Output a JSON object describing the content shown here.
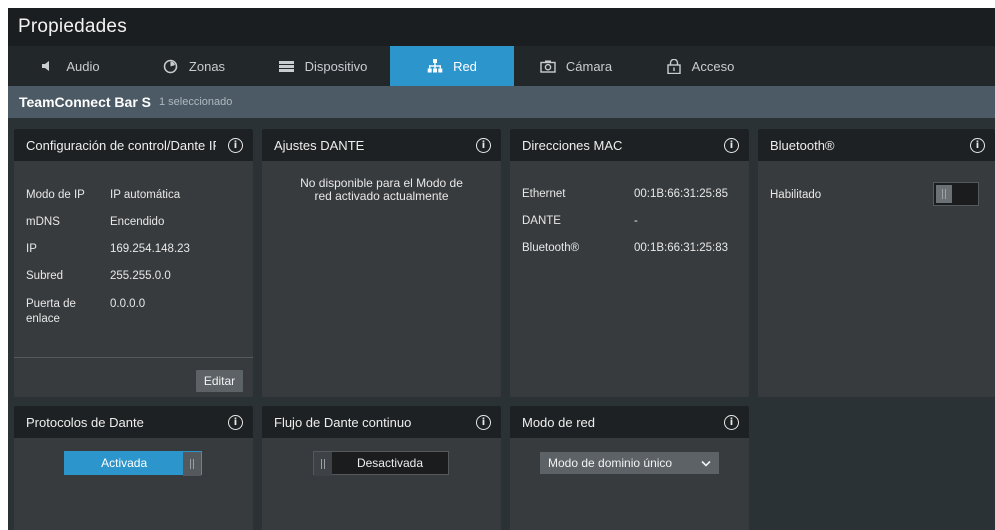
{
  "window": {
    "title": "Propiedades"
  },
  "tabs": [
    {
      "label": "Audio",
      "icon": "speaker-icon"
    },
    {
      "label": "Zonas",
      "icon": "zones-icon"
    },
    {
      "label": "Dispositivo",
      "icon": "device-icon"
    },
    {
      "label": "Red",
      "icon": "network-icon",
      "active": true
    },
    {
      "label": "Cámara",
      "icon": "camera-icon"
    },
    {
      "label": "Acceso",
      "icon": "lock-icon"
    }
  ],
  "device": {
    "name": "TeamConnect Bar S",
    "selection": "1 seleccionado"
  },
  "control_config": {
    "title": "Configuración de control/Dante IP",
    "rows": [
      {
        "key": "Modo de IP",
        "value": "IP automática"
      },
      {
        "key": "mDNS",
        "value": "Encendido"
      },
      {
        "key": "IP",
        "value": "169.254.148.23"
      },
      {
        "key": "Subred",
        "value": "255.255.0.0"
      },
      {
        "key": "Puerta de enlace",
        "value": "0.0.0.0"
      }
    ],
    "edit_label": "Editar"
  },
  "dante_settings": {
    "title": "Ajustes DANTE",
    "message": "No disponible para el Modo de red activado actualmente"
  },
  "mac": {
    "title": "Direcciones MAC",
    "rows": [
      {
        "key": "Ethernet",
        "value": "00:1B:66:31:25:85"
      },
      {
        "key": "DANTE",
        "value": "-"
      },
      {
        "key": "Bluetooth®",
        "value": "00:1B:66:31:25:83"
      }
    ]
  },
  "bluetooth": {
    "title": "Bluetooth®",
    "label": "Habilitado",
    "enabled": false
  },
  "dante_protocols": {
    "title": "Protocolos de Dante",
    "state_label": "Activada",
    "on": true
  },
  "dante_flow": {
    "title": "Flujo de Dante continuo",
    "state_label": "Desactivada",
    "on": false
  },
  "network_mode": {
    "title": "Modo de red",
    "selected": "Modo de dominio único"
  },
  "colors": {
    "accent": "#2c95cb",
    "background": "#2b3236",
    "card": "#383b3e",
    "card_header": "#1e2123"
  }
}
